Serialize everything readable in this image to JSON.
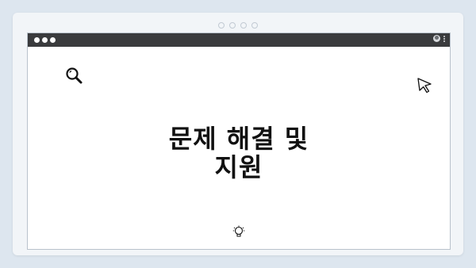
{
  "headline": {
    "line1": "문제 해결 및",
    "line2": "지원"
  },
  "icons": {
    "search": "search-icon",
    "cursor": "cursor-arrow-icon",
    "bulb": "lightbulb-icon",
    "profile": "profile-icon",
    "menu": "kebab-menu-icon"
  },
  "colors": {
    "background": "#dde6ef",
    "titlebar": "#3a3b3d",
    "text": "#111111"
  }
}
